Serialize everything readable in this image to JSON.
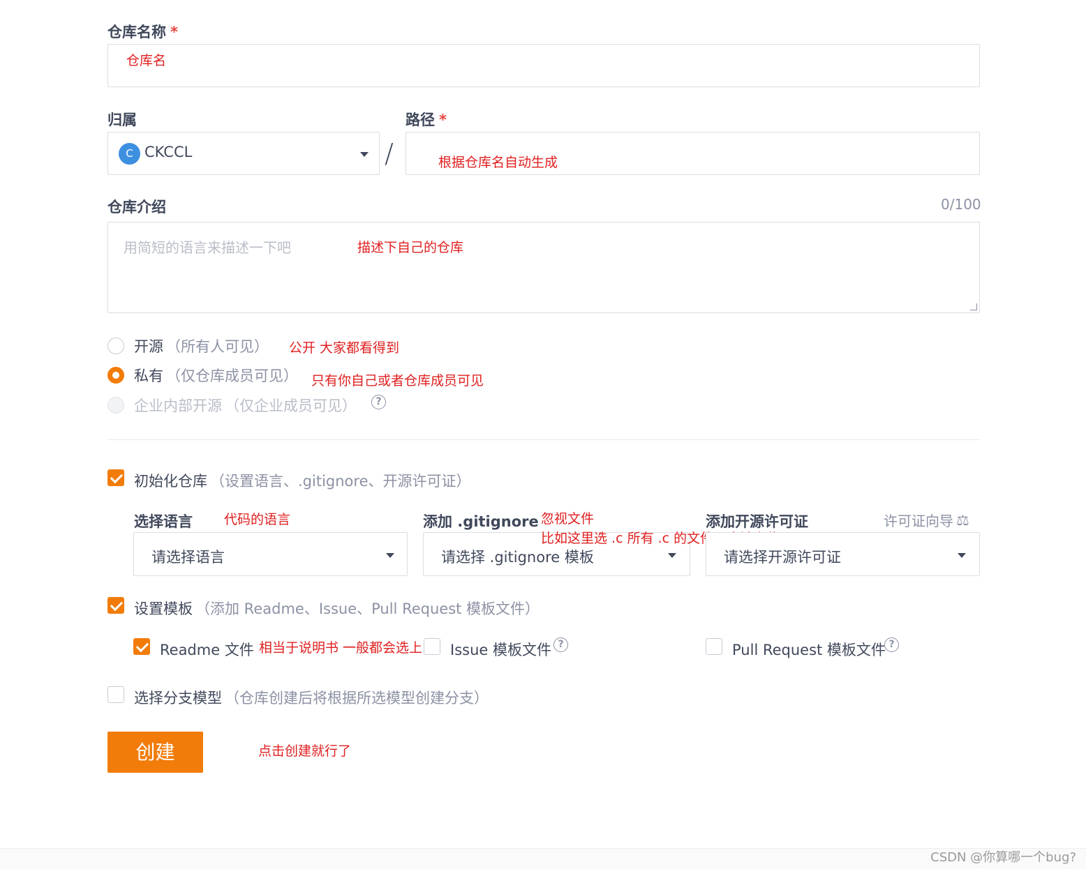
{
  "repo_name": {
    "label": "仓库名称",
    "required_mark": "*",
    "note": "仓库名"
  },
  "owner": {
    "label": "归属",
    "avatar_letter": "C",
    "value": "CKCCL"
  },
  "path": {
    "label": "路径",
    "required_mark": "*",
    "separator": "/",
    "note": "根据仓库名自动生成"
  },
  "description": {
    "label": "仓库介绍",
    "counter": "0/100",
    "placeholder": "用简短的语言来描述一下吧",
    "note": "描述下自己的仓库"
  },
  "visibility": {
    "options": [
      {
        "label": "开源",
        "hint": "（所有人可见）",
        "note": "公开  大家都看得到",
        "state": "unchecked"
      },
      {
        "label": "私有",
        "hint": "（仅仓库成员可见）",
        "note": "只有你自己或者仓库成员可见",
        "state": "checked"
      },
      {
        "label": "企业内部开源",
        "hint": "（仅企业成员可见）",
        "state": "disabled"
      }
    ]
  },
  "init_repo": {
    "label": "初始化仓库",
    "hint": "（设置语言、.gitignore、开源许可证）",
    "checked": true,
    "language": {
      "label": "选择语言",
      "note": "代码的语言",
      "value": "请选择语言"
    },
    "gitignore": {
      "label": "添加 .gitignore",
      "note": "忽视文件",
      "note2": "比如这里选 .c 所有 .c 的文件不会被上传",
      "value": "请选择 .gitignore 模板"
    },
    "license": {
      "label": "添加开源许可证",
      "guide": "许可证向导",
      "guide_icon": "⚖",
      "value": "请选择开源许可证"
    }
  },
  "templates": {
    "label": "设置模板",
    "hint": "（添加 Readme、Issue、Pull Request 模板文件）",
    "checked": true,
    "readme": {
      "label": "Readme 文件",
      "checked": true,
      "note": "相当于说明书  一般都会选上"
    },
    "issue": {
      "label": "Issue 模板文件",
      "checked": false
    },
    "pull_request": {
      "label": "Pull Request 模板文件",
      "checked": false
    },
    "help_glyph": "?"
  },
  "branch_model": {
    "label": "选择分支模型",
    "hint": "（仓库创建后将根据所选模型创建分支）",
    "checked": false
  },
  "submit": {
    "label": "创建",
    "note": "点击创建就行了"
  },
  "watermark": "CSDN @你算哪一个bug?",
  "colors": {
    "accent": "#f27c0a",
    "note": "#e02020",
    "text": "#40485b",
    "muted": "#8c92a4"
  }
}
